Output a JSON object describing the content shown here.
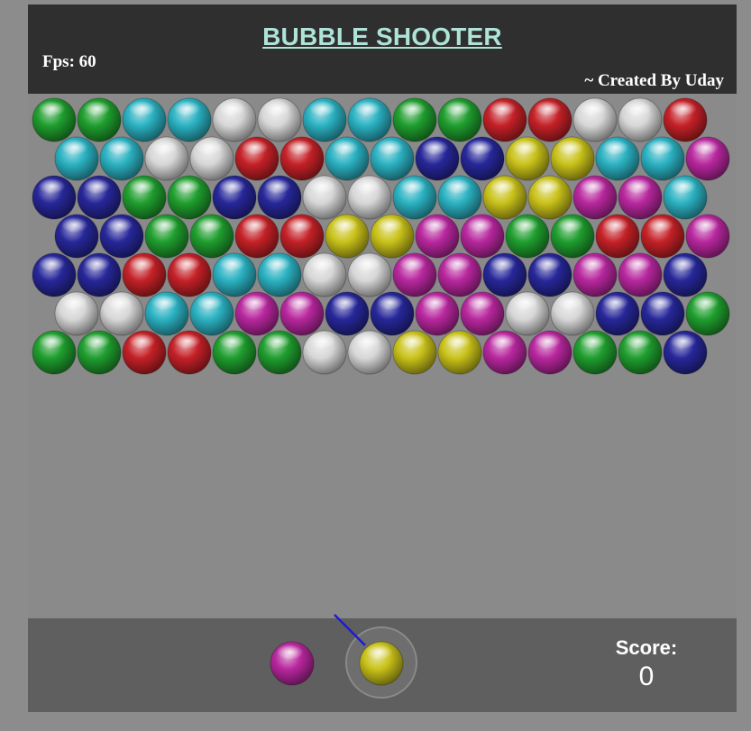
{
  "header": {
    "title": "BUBBLE SHOOTER",
    "fps_text": "Fps: 60",
    "credit": "~ Created By Uday"
  },
  "score": {
    "label": "Score:",
    "value": "0"
  },
  "colors": {
    "green": "#1f9e2e",
    "cyan": "#2bb2c2",
    "white": "#d7d7d7",
    "red": "#c42127",
    "blue": "#27279a",
    "yellow": "#c9c21a",
    "magenta": "#b8279e"
  },
  "grid": {
    "rows": [
      [
        "green",
        "green",
        "cyan",
        "cyan",
        "white",
        "white",
        "cyan",
        "cyan",
        "green",
        "green",
        "red",
        "red",
        "white",
        "white",
        "red"
      ],
      [
        "cyan",
        "cyan",
        "white",
        "white",
        "red",
        "red",
        "cyan",
        "cyan",
        "blue",
        "blue",
        "yellow",
        "yellow",
        "cyan",
        "cyan",
        "magenta"
      ],
      [
        "blue",
        "blue",
        "green",
        "green",
        "blue",
        "blue",
        "white",
        "white",
        "cyan",
        "cyan",
        "yellow",
        "yellow",
        "magenta",
        "magenta",
        "cyan"
      ],
      [
        "blue",
        "blue",
        "green",
        "green",
        "red",
        "red",
        "yellow",
        "yellow",
        "magenta",
        "magenta",
        "green",
        "green",
        "red",
        "red",
        "magenta"
      ],
      [
        "blue",
        "blue",
        "red",
        "red",
        "cyan",
        "cyan",
        "white",
        "white",
        "magenta",
        "magenta",
        "blue",
        "blue",
        "magenta",
        "magenta",
        "blue"
      ],
      [
        "white",
        "white",
        "cyan",
        "cyan",
        "magenta",
        "magenta",
        "blue",
        "blue",
        "magenta",
        "magenta",
        "white",
        "white",
        "blue",
        "blue",
        "green"
      ],
      [
        "green",
        "green",
        "red",
        "red",
        "green",
        "green",
        "white",
        "white",
        "yellow",
        "yellow",
        "magenta",
        "magenta",
        "green",
        "green",
        "blue"
      ]
    ]
  },
  "shooter": {
    "current_bubble": "yellow",
    "next_bubble": "magenta",
    "aim_color": "#1a1adb"
  }
}
